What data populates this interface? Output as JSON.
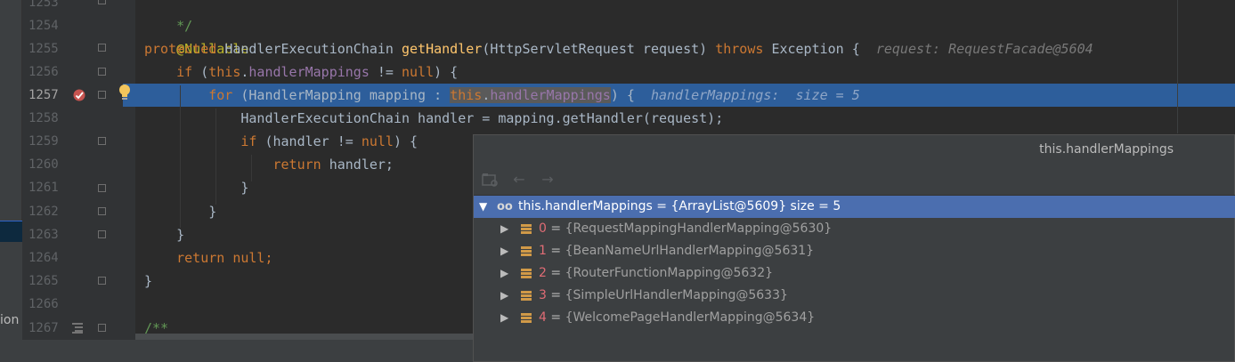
{
  "gutter": {
    "line_numbers": [
      "1253",
      "1254",
      "1255",
      "1256",
      "1257",
      "1258",
      "1259",
      "1260",
      "1261",
      "1262",
      "1263",
      "1264",
      "1265",
      "1266",
      "1267"
    ]
  },
  "code": {
    "l1253": "*/",
    "l1254": "@Nullable",
    "l1255_kw": "protected",
    "l1255_type": "HandlerExecutionChain",
    "l1255_fn": "getHandler",
    "l1255_params": "(HttpServletRequest request)",
    "l1255_throws": "throws",
    "l1255_exc": "Exception {",
    "l1255_hint": "request: RequestFacade@5604",
    "l1256_if": "if",
    "l1256_this": "this",
    "l1256_fld": "handlerMappings",
    "l1256_rest": " != ",
    "l1256_null": "null",
    "l1256_end": ") {",
    "l1257_for": "for",
    "l1257_mid": "(HandlerMapping mapping : ",
    "l1257_this": "this",
    "l1257_fld": "handlerMappings",
    "l1257_end": ") {",
    "l1257_hint": "handlerMappings:  size = 5",
    "l1258": "HandlerExecutionChain handler = mapping.getHandler(request);",
    "l1259_if": "if",
    "l1259_rest": "(handler != ",
    "l1259_null": "null",
    "l1259_end": ") {",
    "l1260_ret": "return",
    "l1260_rest": "handler;",
    "l1261": "}",
    "l1262": "}",
    "l1263": "}",
    "l1264_ret": "return",
    "l1264_null": "null;",
    "l1265": "}",
    "l1267": "/**"
  },
  "left_strip": {
    "cut_text": "ion"
  },
  "popup": {
    "title": "this.handlerMappings",
    "toolbar": {
      "back_icon": "←",
      "forward_icon": "→"
    },
    "root": {
      "name": "this.handlerMappings",
      "value": " = {ArrayList@5609}  size = 5"
    },
    "items": [
      {
        "index": "0",
        "value": "{RequestMappingHandlerMapping@5630}"
      },
      {
        "index": "1",
        "value": "{BeanNameUrlHandlerMapping@5631}"
      },
      {
        "index": "2",
        "value": "{RouterFunctionMapping@5632}"
      },
      {
        "index": "3",
        "value": "{SimpleUrlHandlerMapping@5633}"
      },
      {
        "index": "4",
        "value": "{WelcomePageHandlerMapping@5634}"
      }
    ]
  },
  "colors": {
    "editor_bg": "#2b2b2b",
    "highlight": "#2d5e9b",
    "keyword": "#cc7832",
    "function": "#ffc66d",
    "field": "#9876aa",
    "annotation": "#bbb529",
    "selected_row": "#4b6eaf"
  }
}
